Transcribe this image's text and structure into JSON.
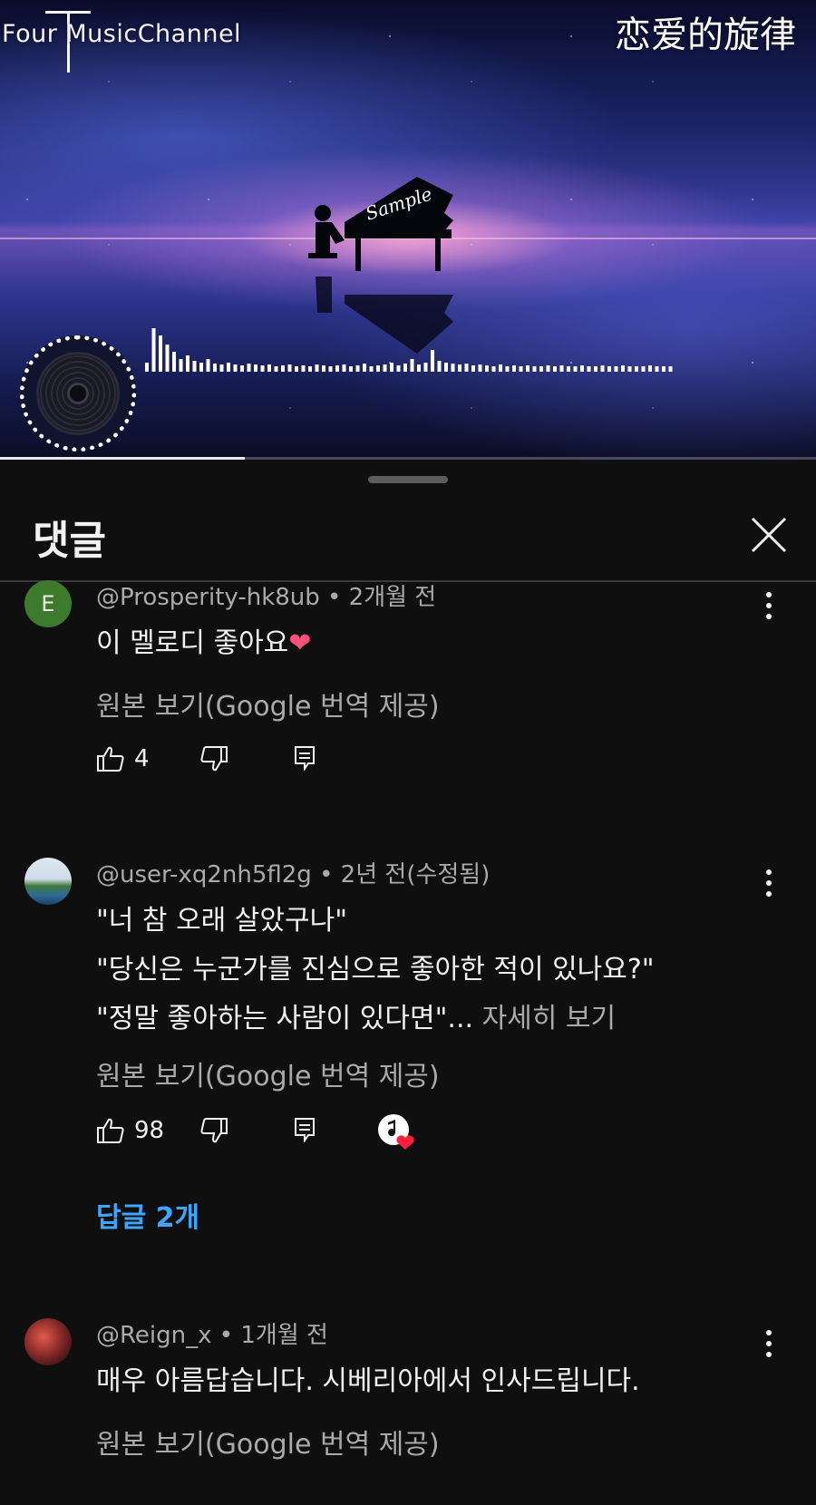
{
  "video": {
    "channel_brand": "Four MusicChannel",
    "song_title": "恋爱的旋律",
    "watermark": "Sample",
    "progress_fraction": 0.3
  },
  "comments_panel": {
    "title": "댓글",
    "close_icon": "close-icon"
  },
  "comments": [
    {
      "avatar_letter": "E",
      "avatar_color": "#3d7a2b",
      "author": "@Prosperity-hk8ub",
      "time": "2개월 전",
      "lines": [
        "이 멜로디 좋아요"
      ],
      "emoji": "❤",
      "translate_label": "원본 보기(Google 번역 제공)",
      "likes": "4"
    },
    {
      "author": "@user-xq2nh5fl2g",
      "time": "2년 전(수정됨)",
      "lines": [
        "\"너 참 오래 살았구나\"",
        "\"당신은 누군가를 진심으로 좋아한 적이 있나요?\"",
        "\"정말 좋아하는 사람이 있다면\"..."
      ],
      "more_label": "자세히 보기",
      "translate_label": "원본 보기(Google 번역 제공)",
      "likes": "98",
      "creator_heart": true,
      "replies_label": "답글 2개"
    },
    {
      "author": "@Reign_x",
      "time": "1개월 전",
      "lines": [
        "매우 아름답습니다. 시베리아에서 인사드립니다."
      ],
      "translate_label": "원본 보기(Google 번역 제공)"
    }
  ],
  "colors": {
    "background": "#0f0f0f",
    "link_blue": "#3ea6ff",
    "secondary_text": "#aaaaaa"
  }
}
